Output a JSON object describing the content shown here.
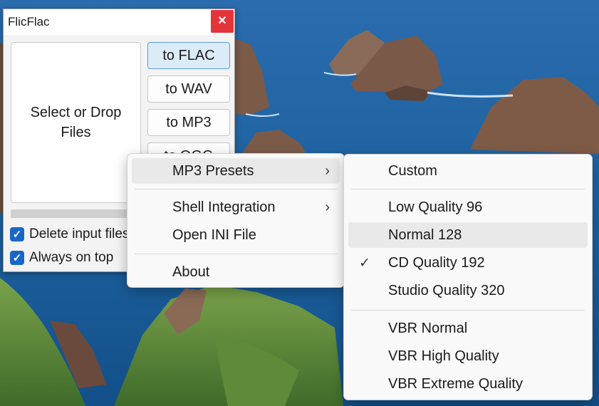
{
  "app": {
    "title": "FlicFlac",
    "close_icon": "✕",
    "drop_zone_label": "Select or Drop Files",
    "buttons": [
      "to FLAC",
      "to WAV",
      "to MP3",
      "to OGG"
    ],
    "checkboxes": [
      {
        "label": "Delete input files",
        "checked": true
      },
      {
        "label": "Always on top",
        "checked": true
      }
    ]
  },
  "menu": {
    "items": [
      {
        "label": "MP3 Presets",
        "has_submenu": true,
        "arrow": "›"
      },
      {
        "label": "Shell Integration",
        "has_submenu": true,
        "arrow": "›"
      },
      {
        "label": "Open INI File"
      },
      {
        "label": "About"
      }
    ]
  },
  "submenu": {
    "check_glyph": "✓",
    "items": [
      {
        "label": "Custom"
      },
      {
        "label": "Low Quality 96"
      },
      {
        "label": "Normal 128",
        "hovered": true
      },
      {
        "label": "CD Quality 192",
        "checked": true
      },
      {
        "label": "Studio Quality 320"
      },
      {
        "label": "VBR Normal"
      },
      {
        "label": "VBR High Quality"
      },
      {
        "label": "VBR Extreme Quality"
      }
    ]
  },
  "colors": {
    "accent": "#1866c7",
    "close": "#e4343a",
    "primary_button_bg": "#dcebf8"
  }
}
